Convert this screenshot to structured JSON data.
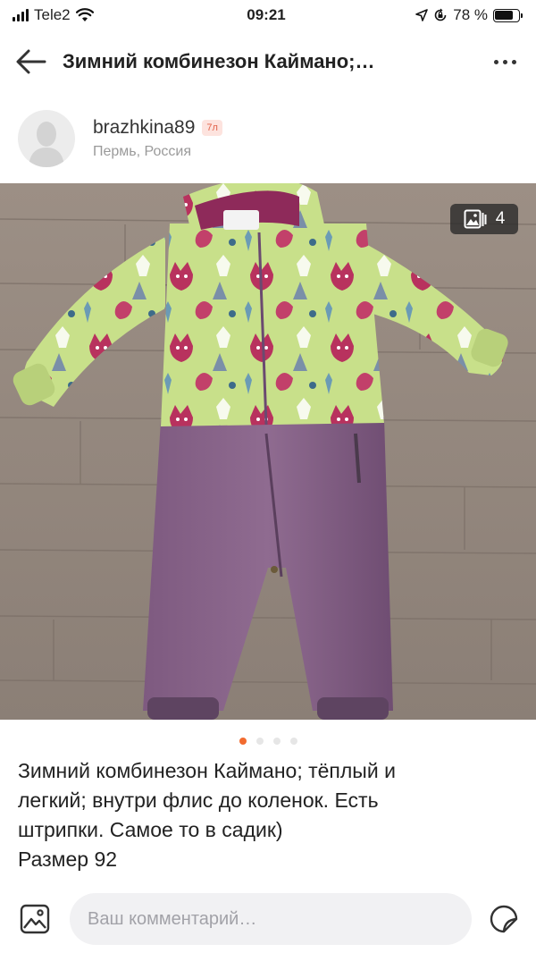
{
  "status_bar": {
    "carrier": "Tele2",
    "time": "09:21",
    "battery_percent": "78 %",
    "battery_level": 0.78
  },
  "nav": {
    "title": "Зимний комбинезон Каймано;…",
    "back_icon": "arrow-left-icon",
    "more_icon": "more-horizontal-icon"
  },
  "author": {
    "username": "brazhkina89",
    "level": "7л",
    "location": "Пермь, Россия"
  },
  "photo": {
    "gallery_count": "4",
    "gallery_icon": "images-icon",
    "current_page": 1,
    "total_pages": 4
  },
  "post": {
    "description": "Зимний комбинезон Каймано; тёплый и\nлегкий; внутри флис до коленок. Есть\nштрипки. Самое то в садик)\nРазмер 92"
  },
  "comment": {
    "placeholder": "Ваш комментарий…",
    "attach_icon": "image-attach-icon",
    "sticker_icon": "sticker-icon"
  },
  "colors": {
    "accent": "#f26b2f",
    "badge_bg": "#fde3de",
    "badge_text": "#e2634b",
    "input_bg": "#f1f1f3"
  }
}
